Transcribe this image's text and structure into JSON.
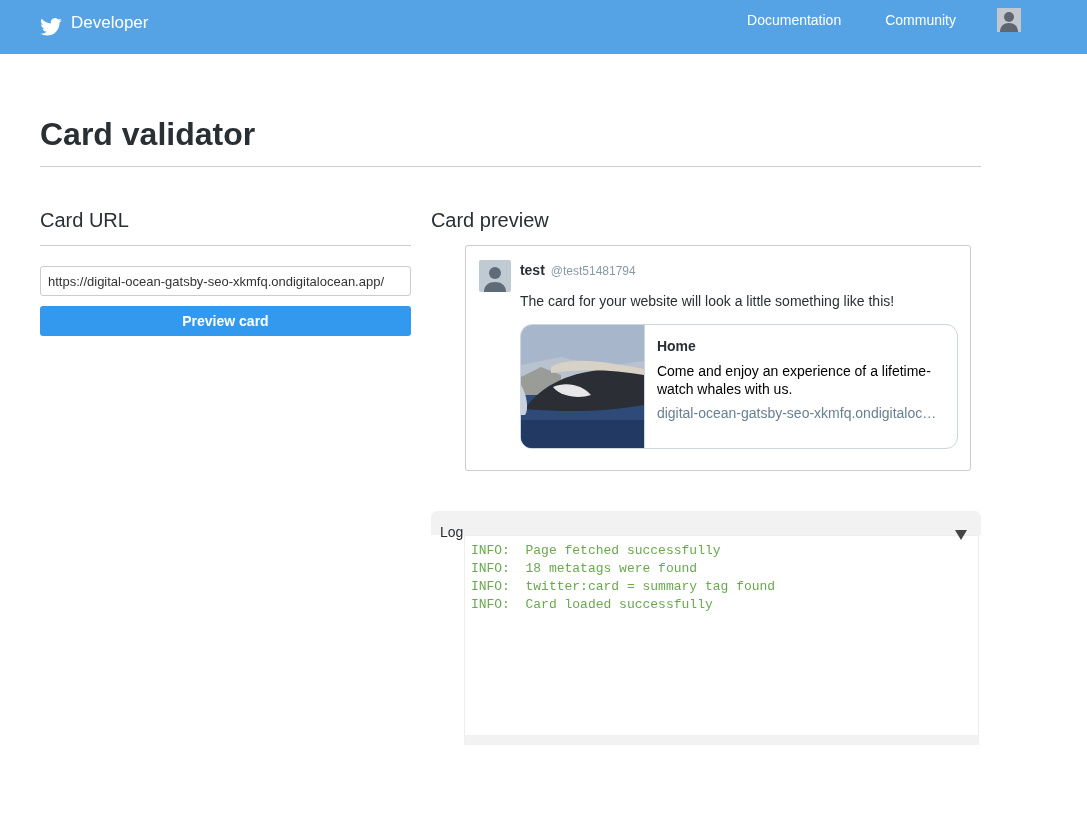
{
  "header": {
    "brand": "Developer",
    "nav": [
      "Documentation",
      "Community"
    ]
  },
  "page_title": "Card validator",
  "card_url": {
    "heading": "Card URL",
    "value": "https://digital-ocean-gatsby-seo-xkmfq.ondigitalocean.app/",
    "button": "Preview card"
  },
  "card_preview": {
    "heading": "Card preview",
    "name": "test",
    "handle": "@test51481794",
    "text": "The card for your website will look a little something like this!",
    "card": {
      "title": "Home",
      "description": "Come and enjoy an experience of a lifetime- watch whales with us.",
      "domain": "digital-ocean-gatsby-seo-xkmfq.ondigitaloc…"
    }
  },
  "log": {
    "label": "Log",
    "expanded": true,
    "lines": [
      "INFO:  Page fetched successfully",
      "INFO:  18 metatags were found",
      "INFO:  twitter:card = summary tag found",
      "INFO:  Card loaded successfully"
    ]
  }
}
